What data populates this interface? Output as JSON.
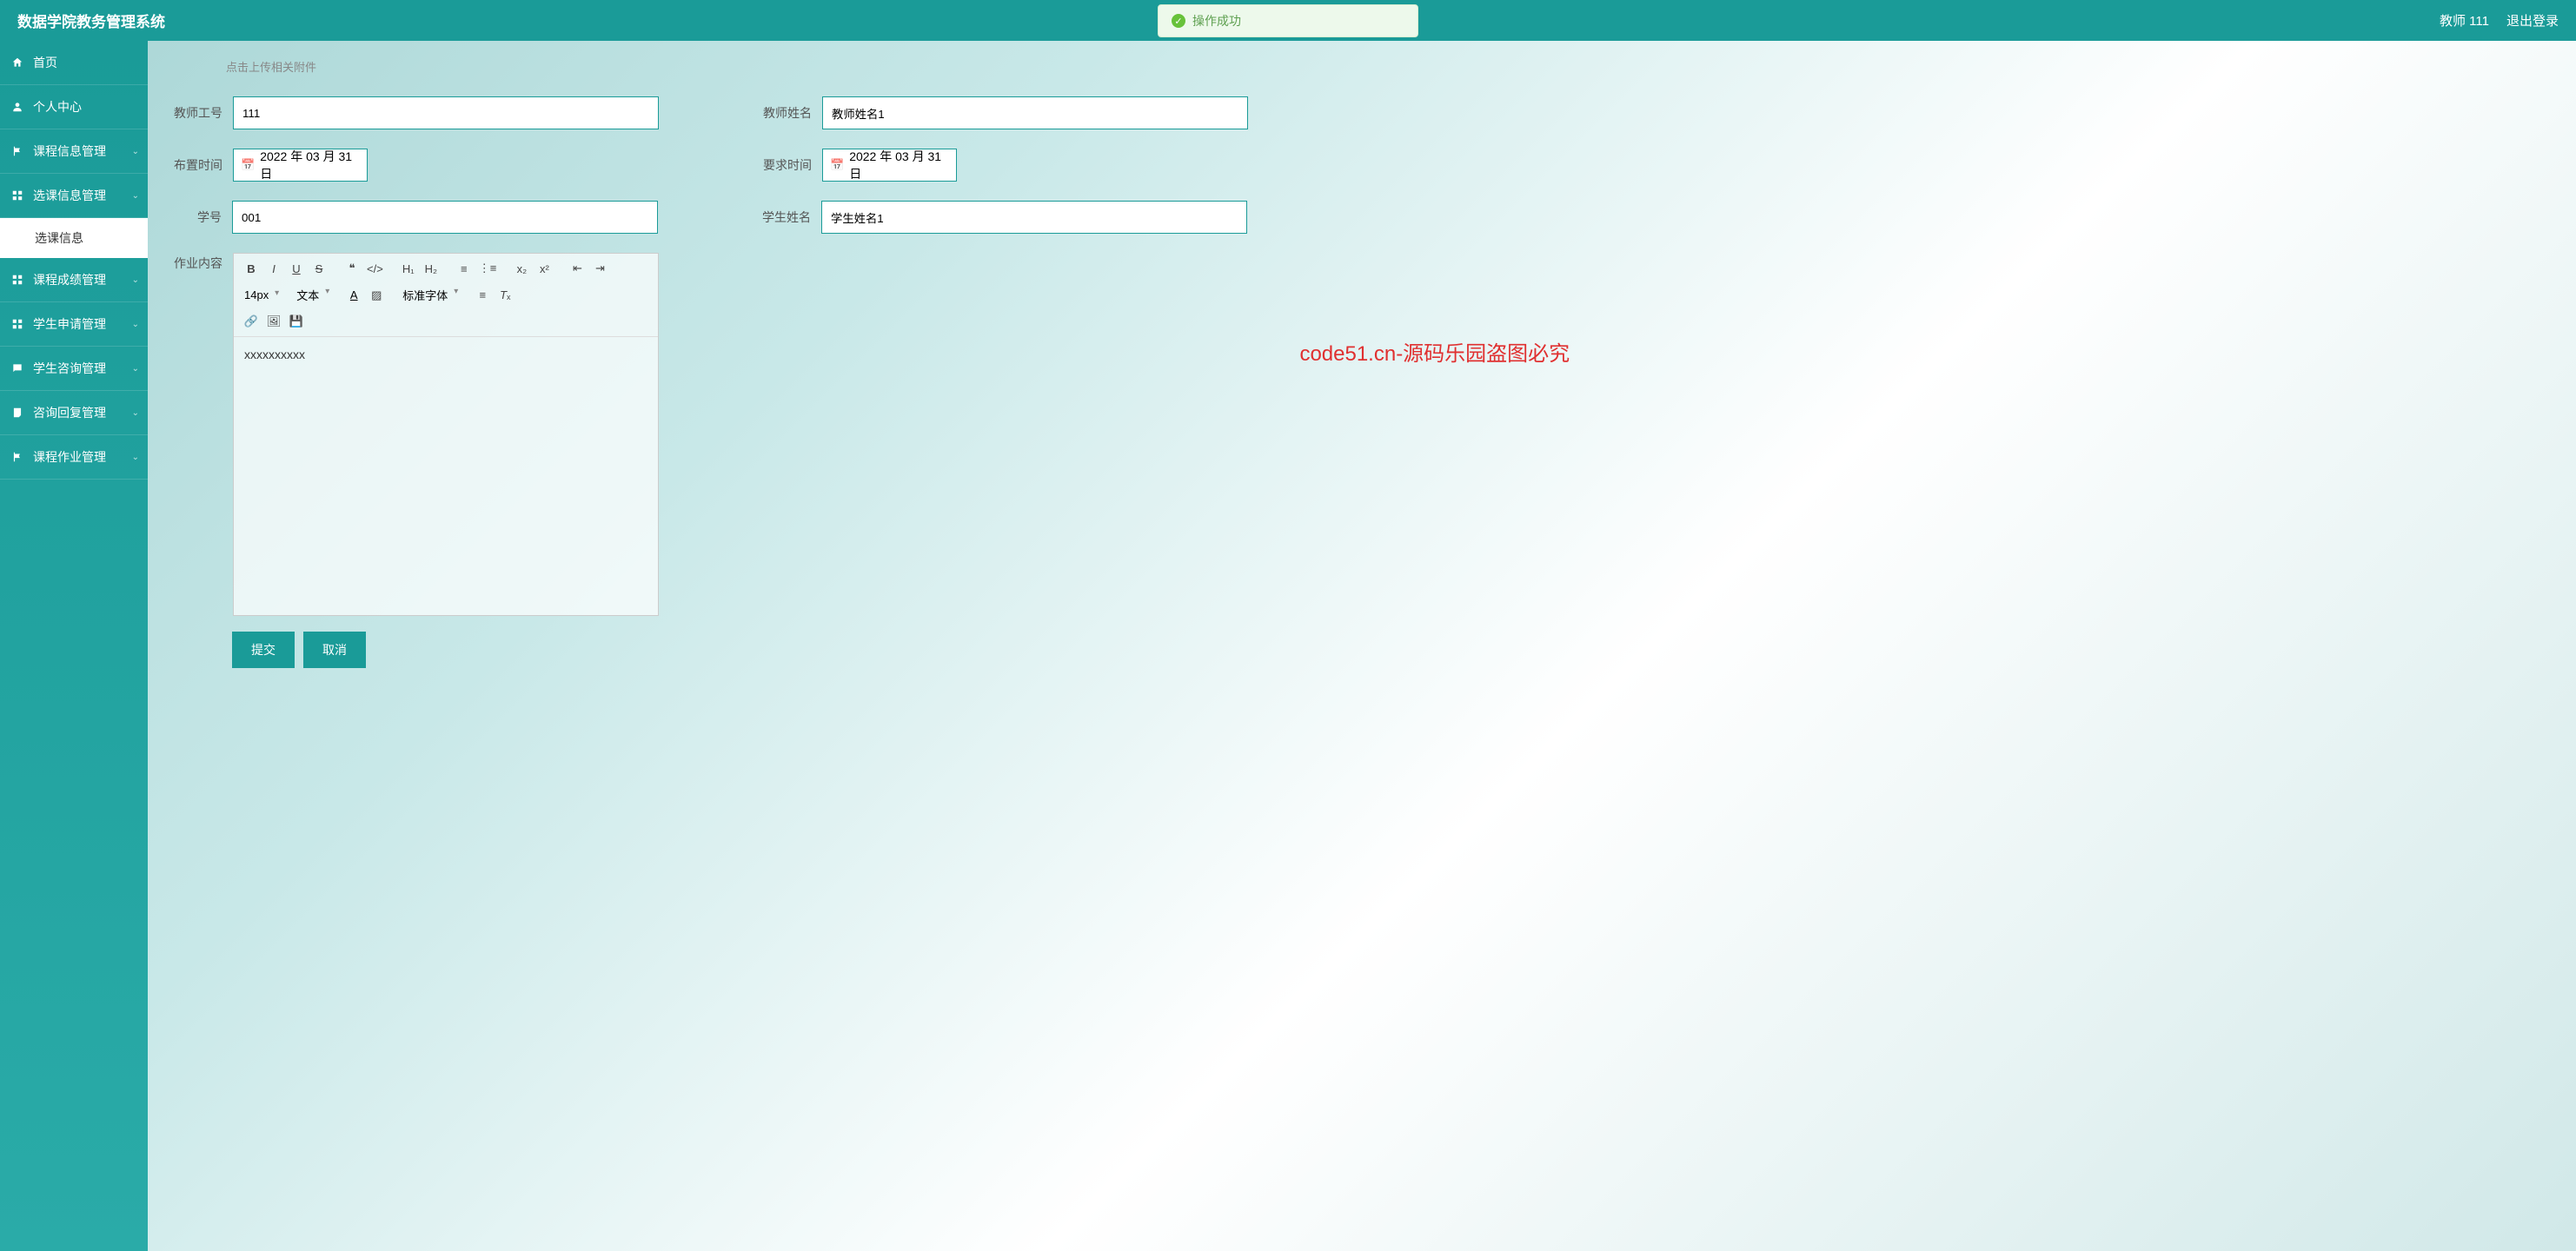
{
  "header": {
    "title": "数据学院教务管理系统",
    "user_role": "教师 111",
    "logout": "退出登录"
  },
  "toast": {
    "message": "操作成功"
  },
  "sidebar": {
    "items": [
      {
        "label": "首页",
        "icon": "home"
      },
      {
        "label": "个人中心",
        "icon": "user"
      },
      {
        "label": "课程信息管理",
        "icon": "flag",
        "expandable": true
      },
      {
        "label": "选课信息管理",
        "icon": "grid",
        "expandable": true,
        "expanded": true,
        "children": [
          {
            "label": "选课信息"
          }
        ]
      },
      {
        "label": "课程成绩管理",
        "icon": "grid",
        "expandable": true
      },
      {
        "label": "学生申请管理",
        "icon": "grid",
        "expandable": true
      },
      {
        "label": "学生咨询管理",
        "icon": "chat",
        "expandable": true
      },
      {
        "label": "咨询回复管理",
        "icon": "note",
        "expandable": true
      },
      {
        "label": "课程作业管理",
        "icon": "flag",
        "expandable": true
      }
    ]
  },
  "form": {
    "upload_hint": "点击上传相关附件",
    "teacher_id_label": "教师工号",
    "teacher_id_value": "111",
    "teacher_name_label": "教师姓名",
    "teacher_name_value": "教师姓名1",
    "assign_time_label": "布置时间",
    "assign_time_value": "2022 年 03 月 31 日",
    "require_time_label": "要求时间",
    "require_time_value": "2022 年 03 月 31 日",
    "student_id_label": "学号",
    "student_id_value": "001",
    "student_name_label": "学生姓名",
    "student_name_value": "学生姓名1",
    "content_label": "作业内容",
    "content_value": "xxxxxxxxxx"
  },
  "toolbar": {
    "font_size": "14px",
    "font_style": "文本",
    "font_family": "标准字体"
  },
  "buttons": {
    "submit": "提交",
    "cancel": "取消"
  },
  "watermark": {
    "main": "code51.cn-源码乐园盗图必究",
    "bg": "code51.cn"
  }
}
